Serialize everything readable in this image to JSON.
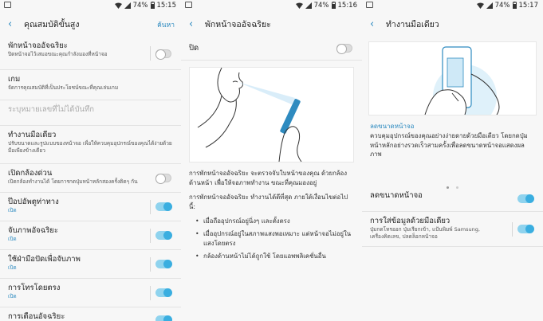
{
  "status": {
    "battery": "74%",
    "times": [
      "15:15",
      "15:16",
      "15:17"
    ]
  },
  "panel1": {
    "title": "คุณสมบัติขั้นสูง",
    "search_label": "ค้นหา",
    "items": [
      {
        "title": "พักหน้าจออัจฉริยะ",
        "subtitle": "ปิดหน้าจอไว้เสมอขณะคุณกำลังมองที่หน้าจอ",
        "toggle": "off"
      },
      {
        "title": "เกม",
        "subtitle": "จัดการคุณสมบัติที่เป็นประโยชน์ขณะที่คุณเล่นเกม"
      },
      {
        "title": "ระบุหมายเลขที่ไม่ได้บันทึก",
        "subtitle": ""
      },
      {
        "title": "ทำงานมือเดียว",
        "subtitle": "ปรับขนาดและรูปแบบของหน้าจอ เพื่อให้ควบคุมอุปกรณ์ของคุณได้ง่ายด้วยมือเพียงข้างเดียว"
      },
      {
        "title": "เปิดกล้องด่วน",
        "subtitle": "เปิดกล้องทำงานได้ โดยการกดปุ่มหน้าหลักสองครั้งติดๆ กัน",
        "toggle": "off"
      },
      {
        "title": "ป๊อปอัพตูท่าทาง",
        "subtitle": "เปิด",
        "toggle": "on"
      },
      {
        "title": "จับภาพอัจฉริยะ",
        "subtitle": "เปิด",
        "toggle": "on"
      },
      {
        "title": "ใช้ฝ่ามือปัดเพื่อจับภาพ",
        "subtitle": "เปิด",
        "toggle": "on"
      },
      {
        "title": "การโทรโดยตรง",
        "subtitle": "เปิด",
        "toggle": "on"
      },
      {
        "title": "การเตือนอัจฉริยะ",
        "subtitle": "",
        "toggle": "on"
      }
    ]
  },
  "panel2": {
    "title": "พักหน้าจออัจฉริยะ",
    "off_label": "ปิด",
    "desc1": "การพักหน้าจออัจฉริยะ จะตรวจจับใบหน้าของคุณ ด้วยกล้องด้านหน้า เพื่อให้จอภาพทำงาน ขณะที่คุณมองอยู่",
    "desc2": "การพักหน้าจออัจฉริยะ ทำงานได้ดีที่สุด ภายใต้เงื่อนไขต่อไปนี้:",
    "bullets": [
      "เมื่อถืออุปกรณ์อยู่นิ่งๆ และตั้งตรง",
      "เมื่ออุปกรณ์อยู่ในสภาพแสงพอเหมาะ แต่หน้าจอไม่อยู่ในแสงโดยตรง",
      "กล้องด้านหน้าไม่ได้ถูกใช้ โดยแอพพลิเคชั่นอื่น"
    ]
  },
  "panel3": {
    "title": "ทำงานมือเดียว",
    "caption_title": "ลดขนาดหน้าจอ",
    "caption_desc": "ควบคุมอุปกรณ์ของคุณอย่างง่ายดายด้วยมือเดียว โดยกดปุ่มหน้าหลักอย่างรวดเร็วสามครั้งเพื่อลดขนาดหน้าจอแสดงผลภาพ",
    "items": [
      {
        "title": "ลดขนาดหน้าจอ",
        "subtitle": "",
        "toggle": "on"
      },
      {
        "title": "การใส่ข้อมูลด้วยมือเดียว",
        "subtitle": "ปุ่มกดโทรออก ปุ่มเรียกเข้า, แป้นพิมพ์ Samsung, เครื่องคิดเลข, ปลดล็อกหน้าจอ",
        "toggle": "on"
      }
    ]
  },
  "colors": {
    "accent": "#2e8bc0",
    "toggle_on": "#3aaee0"
  }
}
